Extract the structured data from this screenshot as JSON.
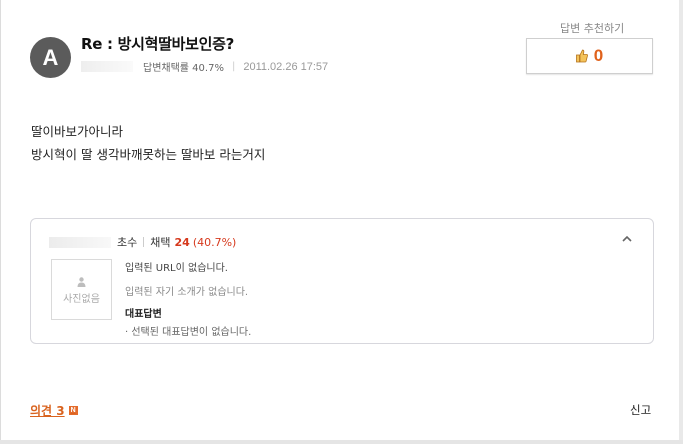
{
  "answer": {
    "avatar_letter": "A",
    "title": "Re : 방시혁딸바보인증?",
    "adopt_rate_label": "답변채택률 40.7%",
    "date": "2011.02.26 17:57",
    "recommend_label": "답변 추천하기",
    "recommend_count": "0",
    "body_lines": [
      "딸이바보가아니라",
      "방시혁이 딸 생각바깨못하는 딸바보 라는거지"
    ]
  },
  "profile": {
    "grade": "초수",
    "adopt_label": "채택",
    "adopt_count": "24",
    "adopt_rate": "(40.7%)",
    "no_photo": "사진없음",
    "url_line": "입력된 URL이 없습니다.",
    "intro_line": "입력된 자기 소개가 없습니다.",
    "rep_title": "대표답변",
    "rep_line": "· 선택된 대표답변이 없습니다."
  },
  "footer": {
    "opinion_label": "의견 3",
    "new_badge": "N",
    "report_label": "신고"
  },
  "colors": {
    "accent": "#e0621c",
    "adopt_red": "#d6391d",
    "avatar_bg": "#5b5b5b"
  },
  "icons": [
    "thumbs-up-icon",
    "chevron-up-icon",
    "person-icon",
    "new-badge-icon"
  ]
}
